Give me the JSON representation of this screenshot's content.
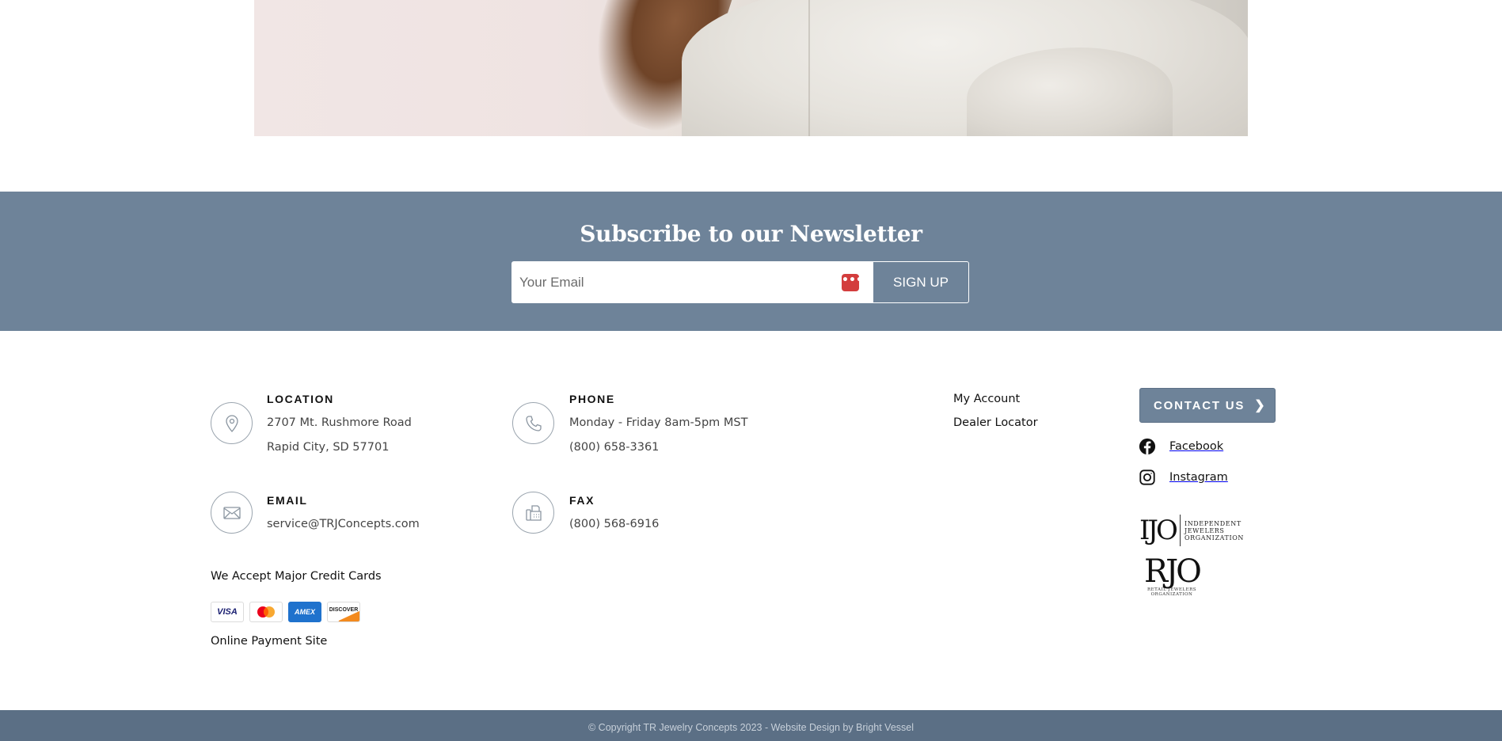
{
  "newsletter": {
    "title": "Subscribe to our Newsletter",
    "email_placeholder": "Your Email",
    "password_manager_icon": "•••",
    "signup_label": "SIGN UP"
  },
  "location": {
    "title": "LOCATION",
    "line1": "2707 Mt. Rushmore Road",
    "line2": "Rapid City, SD 57701",
    "icon": "map-pin-icon"
  },
  "phone": {
    "title": "PHONE",
    "hours": "Monday - Friday 8am-5pm MST",
    "number": "(800) 658-3361",
    "icon": "phone-icon"
  },
  "email": {
    "title": "EMAIL",
    "address": "service@TRJConcepts.com",
    "icon": "envelope-icon"
  },
  "fax": {
    "title": "FAX",
    "number": "(800) 568-6916",
    "icon": "fax-icon"
  },
  "links": {
    "my_account": "My Account",
    "dealer_locator": "Dealer Locator"
  },
  "contact_button": {
    "label": "CONTACT US",
    "chevron": "❯"
  },
  "social": {
    "facebook": "Facebook",
    "instagram": "Instagram"
  },
  "payments": {
    "heading": "We Accept Major Credit Cards",
    "cards": [
      "VISA",
      "MasterCard",
      "AMEX",
      "DISCOVER"
    ],
    "online_payment": "Online Payment Site"
  },
  "logos": {
    "ijo_mark": "IJO",
    "ijo_words": [
      "INDEPENDENT",
      "JEWELERS",
      "ORGANIZATION"
    ],
    "rjo_mark": "RJO",
    "rjo_words": [
      "RETAIL JEWELERS",
      "ORGANIZATION"
    ]
  },
  "footer": {
    "copyright": "© Copyright TR Jewelry Concepts 2023 - Website Design by Bright Vessel"
  },
  "colors": {
    "band": "#6e8399",
    "bottom_bar": "#5b6f85",
    "white": "#ffffff"
  }
}
